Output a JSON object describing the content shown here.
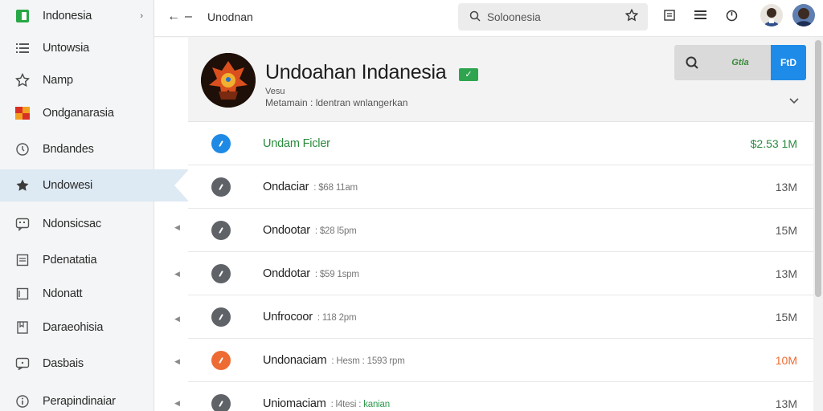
{
  "sidebar": {
    "header": {
      "label": "Indonesia",
      "icon": "green-square-icon"
    },
    "items": [
      {
        "label": "Untowsia",
        "icon": "list-icon"
      },
      {
        "label": "Namp",
        "icon": "star-outline-icon"
      },
      {
        "label": "Ondganarasia",
        "icon": "flag-icon"
      },
      {
        "label": "Bndandes",
        "icon": "clock-icon"
      },
      {
        "label": "Undowesi",
        "icon": "star-filled-icon",
        "active": true
      },
      {
        "label": "Ndonsicsac",
        "icon": "message-icon"
      },
      {
        "label": "Pdenatatia",
        "icon": "document-icon"
      },
      {
        "label": "Ndonatt",
        "icon": "page-icon"
      },
      {
        "label": "Daraeohisia",
        "icon": "bookmark-icon"
      },
      {
        "label": "Dasbais",
        "icon": "chat-icon"
      },
      {
        "label": "Perapindinaiar",
        "icon": "info-icon"
      }
    ]
  },
  "topbar": {
    "back": "←",
    "dash": "–",
    "title": "Unodnan",
    "search_placeholder": "Soloonesia"
  },
  "header": {
    "title": "Undoahan Indanesia",
    "subtitle": "Vesu",
    "description": "Metamain : ldentran wnlangerkan",
    "action_label": "Gtla",
    "action_primary": "FtD"
  },
  "rows": [
    {
      "name": "Undam Ficler",
      "meta": "",
      "meta_hl": "",
      "size": "$2.53 1M",
      "style": "first"
    },
    {
      "name": "Ondaciar",
      "meta": ": $68 11am",
      "meta_hl": "",
      "size": "13M",
      "style": ""
    },
    {
      "name": "Ondootar",
      "meta": ": $28 l5pm",
      "meta_hl": "",
      "size": "15M",
      "style": ""
    },
    {
      "name": "Onddotar",
      "meta": ": $59 1spm",
      "meta_hl": "",
      "size": "13M",
      "style": ""
    },
    {
      "name": "Unfrocoor",
      "meta": ": 118 2pm",
      "meta_hl": "",
      "size": "15M",
      "style": ""
    },
    {
      "name": "Undonaciam",
      "meta": ": Hesm : 1593 rpm",
      "meta_hl": "",
      "size": "10M",
      "style": "orange"
    },
    {
      "name": "Uniomaciam",
      "meta": ": l4tesi :",
      "meta_hl": "kanian",
      "size": "13M",
      "style": ""
    }
  ],
  "colors": {
    "accent_blue": "#1f8ae6",
    "accent_green": "#2b8a3e",
    "accent_orange": "#ee6b33",
    "sidebar_bg": "#f4f5f6",
    "active_bg": "#dde9f3"
  }
}
